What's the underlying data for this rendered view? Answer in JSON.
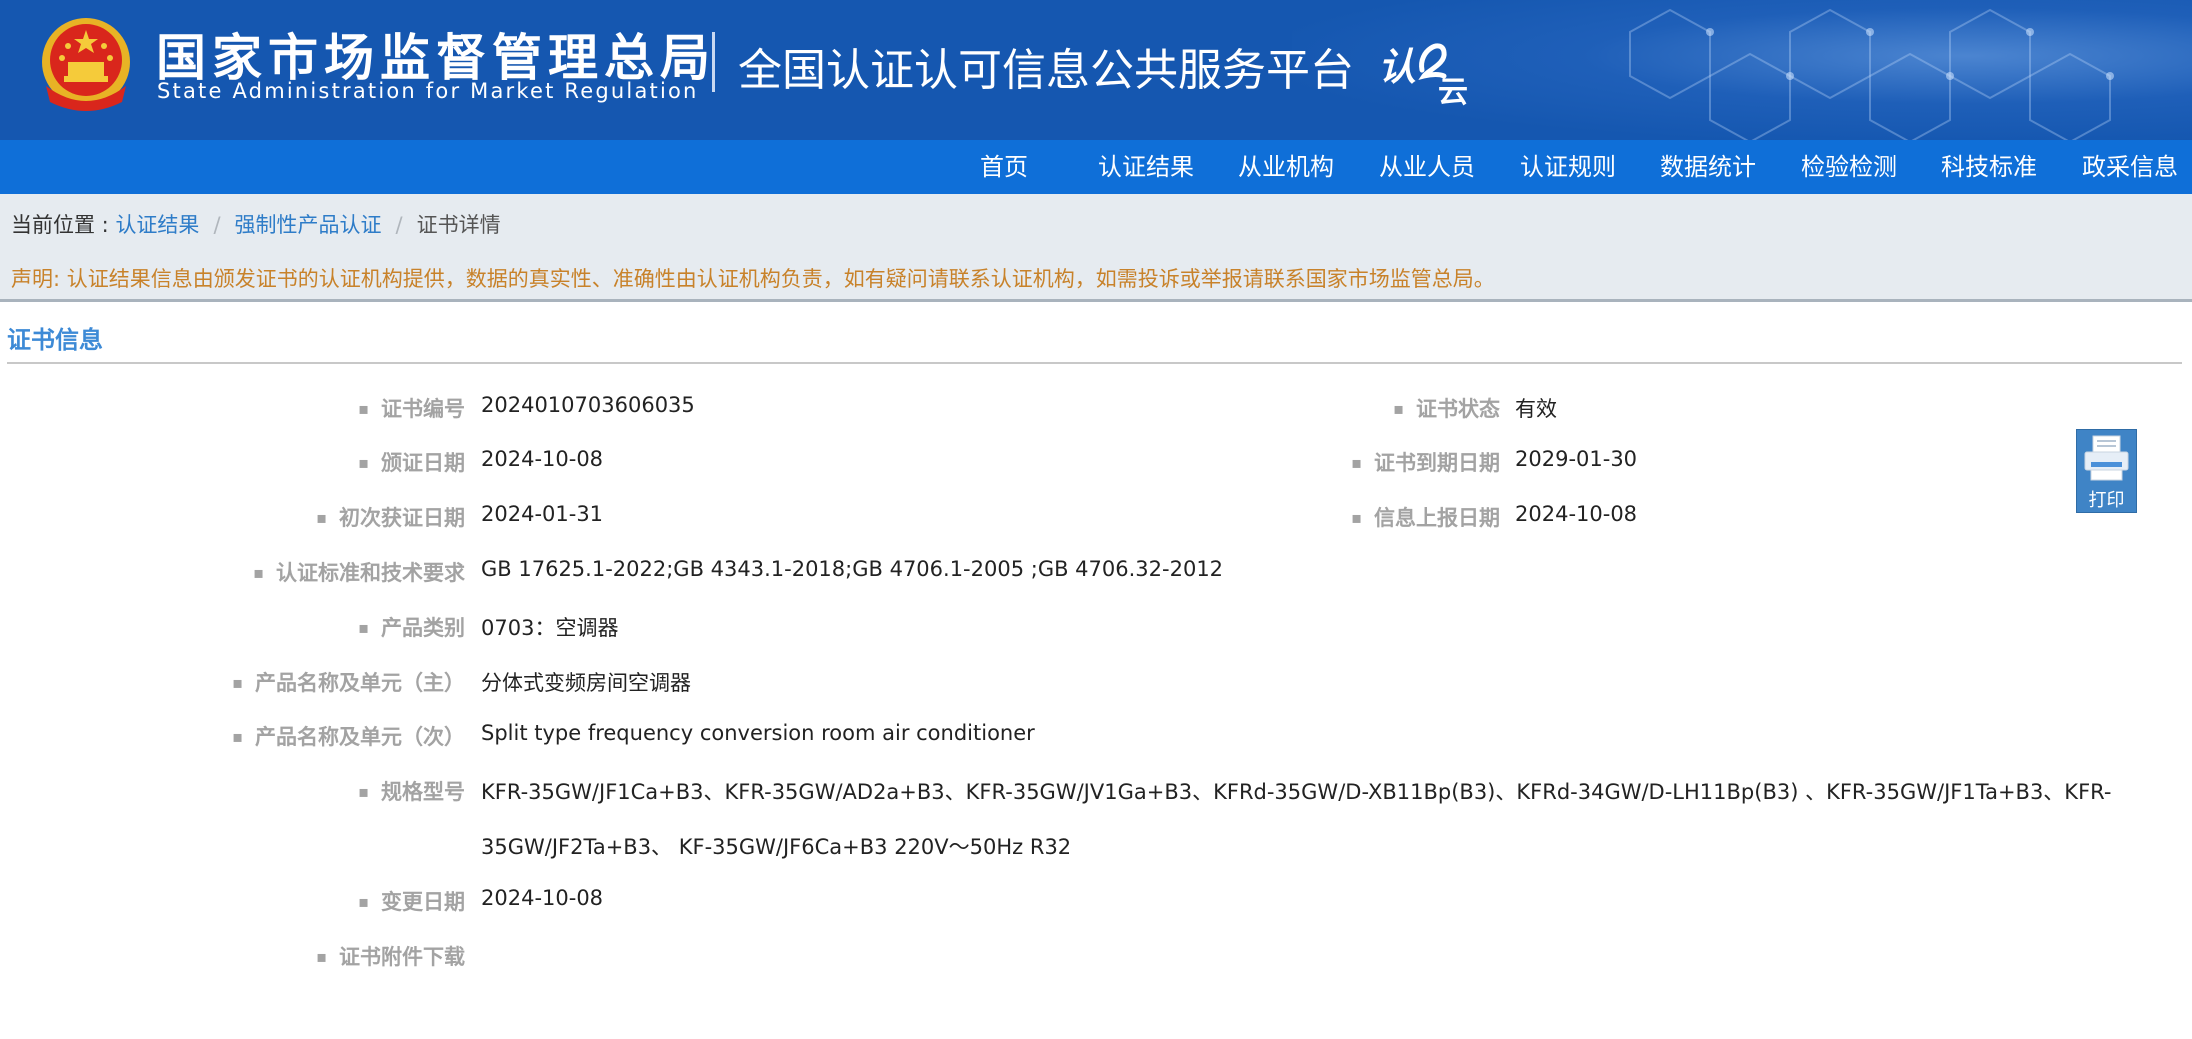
{
  "header": {
    "org_name_cn": "国家市场监督管理总局",
    "org_name_en": "State Administration for Market Regulation",
    "platform_name": "全国认证认可信息公共服务平台",
    "logo_text": "认e云"
  },
  "nav": {
    "items": [
      "首页",
      "认证结果",
      "从业机构",
      "从业人员",
      "认证规则",
      "数据统计",
      "检验检测",
      "科技标准",
      "政采信息"
    ]
  },
  "breadcrumb": {
    "prefix": "当前位置 : ",
    "items": [
      "认证结果",
      "强制性产品认证",
      "证书详情"
    ]
  },
  "notice": "声明: 认证结果信息由颁发证书的认证机构提供，数据的真实性、准确性由认证机构负责，如有疑问请联系认证机构，如需投诉或举报请联系国家市场监管总局。",
  "section": {
    "title": "证书信息"
  },
  "fields": {
    "cert_no": {
      "label": "证书编号",
      "value": "2024010703606035"
    },
    "cert_status": {
      "label": "证书状态",
      "value": "有效"
    },
    "issue_date": {
      "label": "颁证日期",
      "value": "2024-10-08"
    },
    "expire_date": {
      "label": "证书到期日期",
      "value": "2029-01-30"
    },
    "first_date": {
      "label": "初次获证日期",
      "value": "2024-01-31"
    },
    "report_date": {
      "label": "信息上报日期",
      "value": "2024-10-08"
    },
    "standards": {
      "label": "认证标准和技术要求",
      "value": "GB 17625.1-2022;GB 4343.1-2018;GB 4706.1-2005 ;GB 4706.32-2012"
    },
    "category": {
      "label": "产品类别",
      "value": "0703：空调器"
    },
    "name_main": {
      "label": "产品名称及单元（主）",
      "value": "分体式变频房间空调器"
    },
    "name_sub": {
      "label": "产品名称及单元（次）",
      "value": "Split type frequency conversion room air conditioner"
    },
    "model": {
      "label": "规格型号",
      "value_line1": "KFR-35GW/JF1Ca+B3、KFR-35GW/AD2a+B3、KFR-35GW/JV1Ga+B3、KFRd-35GW/D-XB11Bp(B3)、KFRd-34GW/D-LH11Bp(B3) 、KFR-35GW/JF1Ta+B3、KFR-",
      "value_line2": "35GW/JF2Ta+B3、 KF-35GW/JF6Ca+B3 220V～50Hz R32"
    },
    "change_date": {
      "label": "变更日期",
      "value": "2024-10-08"
    },
    "attachment": {
      "label": "证书附件下载"
    }
  },
  "print_button": {
    "label": "打印"
  }
}
